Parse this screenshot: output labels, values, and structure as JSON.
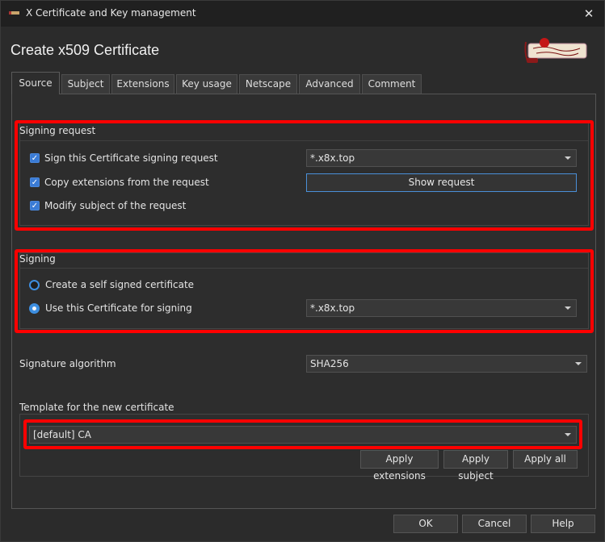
{
  "window": {
    "title": "X Certificate and Key management",
    "close_glyph": "✕"
  },
  "heading": "Create x509 Certificate",
  "tabs": [
    "Source",
    "Subject",
    "Extensions",
    "Key usage",
    "Netscape",
    "Advanced",
    "Comment"
  ],
  "active_tab": "Source",
  "signing_request": {
    "title": "Signing request",
    "sign_csr": {
      "label": "Sign this Certificate signing request",
      "checked": true
    },
    "copy_ext": {
      "label": "Copy extensions from the request",
      "checked": true
    },
    "modify_subject": {
      "label": "Modify subject of the request",
      "checked": true
    },
    "request_select": "*.x8x.top",
    "show_request": "Show request"
  },
  "signing": {
    "title": "Signing",
    "self_signed": {
      "label": "Create a self signed certificate",
      "checked": false
    },
    "use_cert": {
      "label": "Use this Certificate for signing",
      "checked": true
    },
    "cert_select": "*.x8x.top"
  },
  "signature_algorithm": {
    "label": "Signature algorithm",
    "value": "SHA256"
  },
  "template": {
    "title": "Template for the new certificate",
    "value": "[default] CA",
    "apply_extensions": "Apply extensions",
    "apply_subject": "Apply subject",
    "apply_all": "Apply all"
  },
  "footer": {
    "ok": "OK",
    "cancel": "Cancel",
    "help": "Help"
  },
  "colors": {
    "highlight": "#ff0000",
    "accent": "#3d8ee0",
    "background": "#2b2b2b"
  },
  "icons": [
    "app-icon",
    "close-icon",
    "logo-scroll-icon",
    "checkbox-check-icon",
    "chevron-down-icon"
  ]
}
